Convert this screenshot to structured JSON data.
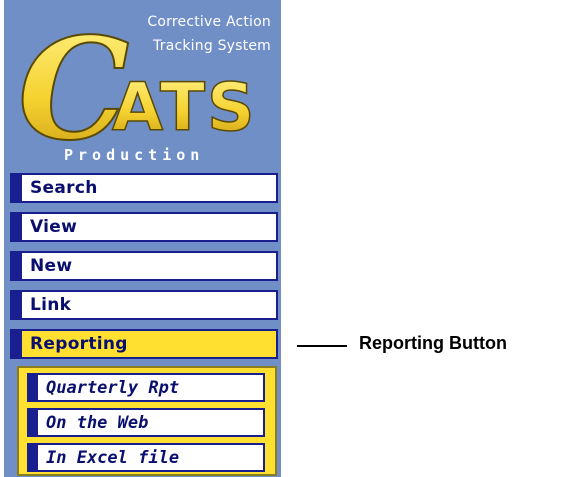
{
  "logo": {
    "letter": "C",
    "letters": "ATS",
    "system_line1": "Corrective Action",
    "system_line2": "Tracking System",
    "environment": "Production"
  },
  "menu": {
    "items": [
      {
        "label": "Search",
        "active": false
      },
      {
        "label": "View",
        "active": false
      },
      {
        "label": "New",
        "active": false
      },
      {
        "label": "Link",
        "active": false
      },
      {
        "label": "Reporting",
        "active": true
      }
    ]
  },
  "submenu": {
    "items": [
      {
        "label": "Quarterly Rpt"
      },
      {
        "label": "On the Web"
      },
      {
        "label": "In Excel file"
      }
    ]
  },
  "callout": {
    "text": "Reporting Button"
  },
  "colors": {
    "panel_bg": "#6f8fc6",
    "button_border": "#1a1f8f",
    "button_text": "#0a0f6e",
    "active_bg": "#ffe030",
    "logo_yellow": "#f5d230"
  }
}
